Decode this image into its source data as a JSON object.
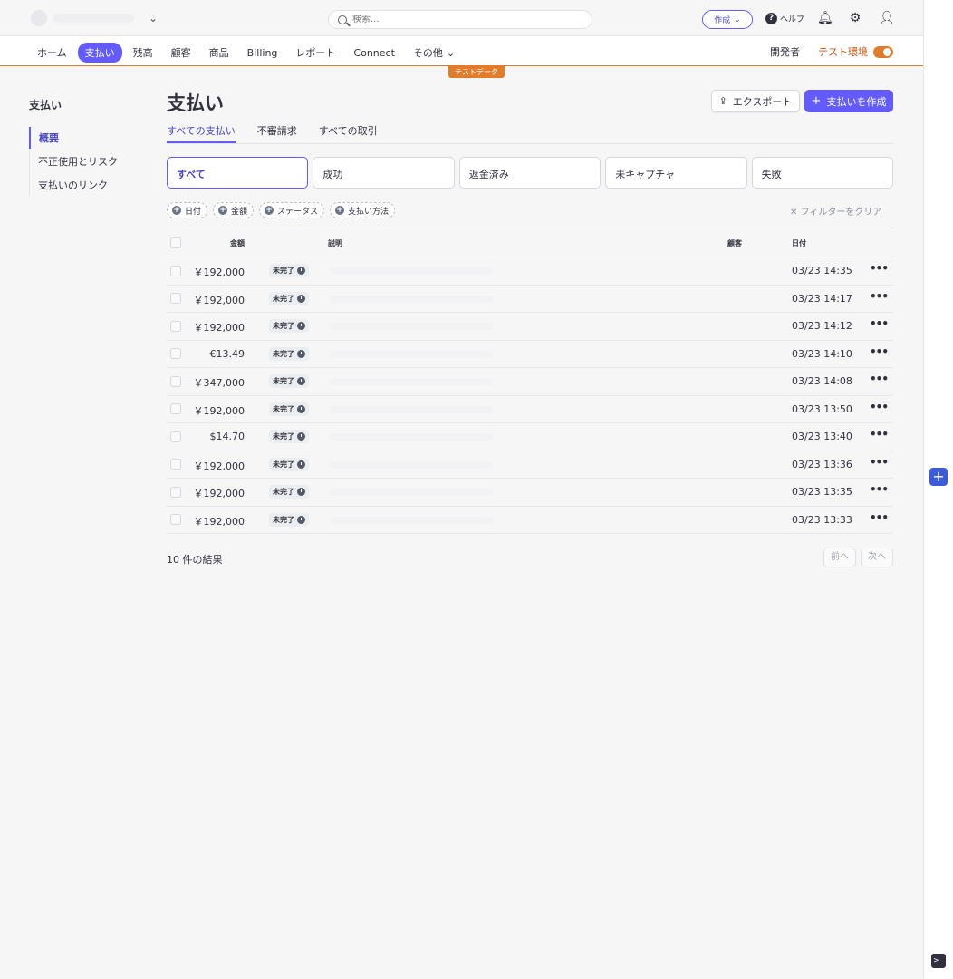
{
  "search": {
    "placeholder": "検索..."
  },
  "topbar": {
    "create_label": "作成",
    "help_label": "ヘルプ"
  },
  "nav": {
    "items": [
      {
        "label": "ホーム",
        "name": "nav-home",
        "active": false
      },
      {
        "label": "支払い",
        "name": "nav-payments",
        "active": true
      },
      {
        "label": "残高",
        "name": "nav-balances",
        "active": false
      },
      {
        "label": "顧客",
        "name": "nav-customers",
        "active": false
      },
      {
        "label": "商品",
        "name": "nav-products",
        "active": false
      },
      {
        "label": "Billing",
        "name": "nav-billing",
        "active": false
      },
      {
        "label": "レポート",
        "name": "nav-reports",
        "active": false
      },
      {
        "label": "Connect",
        "name": "nav-connect",
        "active": false
      },
      {
        "label": "その他",
        "name": "nav-more",
        "active": false
      }
    ],
    "developers": "開発者",
    "test_mode": "テスト環境",
    "test_badge": "テストデータ"
  },
  "sidebar": {
    "title": "支払い",
    "items": [
      {
        "label": "概要",
        "active": true
      },
      {
        "label": "不正使用とリスク",
        "active": false
      },
      {
        "label": "支払いのリンク",
        "active": false
      }
    ]
  },
  "page": {
    "title": "支払い",
    "export_label": "エクスポート",
    "create_label": "支払いを作成"
  },
  "tabs": [
    {
      "label": "すべての支払い",
      "active": true
    },
    {
      "label": "不審請求",
      "active": false
    },
    {
      "label": "すべての取引",
      "active": false
    }
  ],
  "status_filters": [
    {
      "label": "すべて",
      "active": true
    },
    {
      "label": "成功",
      "active": false
    },
    {
      "label": "返金済み",
      "active": false
    },
    {
      "label": "未キャプチャ",
      "active": false
    },
    {
      "label": "失敗",
      "active": false
    }
  ],
  "chips": [
    "日付",
    "金額",
    "ステータス",
    "支払い方法"
  ],
  "clear_filters": "フィルターをクリア",
  "table": {
    "headers": {
      "amount": "金額",
      "description": "説明",
      "customer": "顧客",
      "date": "日付"
    },
    "rows": [
      {
        "amount": "￥192,000",
        "status": "未完了",
        "date": "03/23 14:35"
      },
      {
        "amount": "￥192,000",
        "status": "未完了",
        "date": "03/23 14:17"
      },
      {
        "amount": "￥192,000",
        "status": "未完了",
        "date": "03/23 14:12"
      },
      {
        "amount": "€13.49",
        "status": "未完了",
        "date": "03/23 14:10"
      },
      {
        "amount": "￥347,000",
        "status": "未完了",
        "date": "03/23 14:08"
      },
      {
        "amount": "￥192,000",
        "status": "未完了",
        "date": "03/23 13:50"
      },
      {
        "amount": "$14.70",
        "status": "未完了",
        "date": "03/23 13:40"
      },
      {
        "amount": "￥192,000",
        "status": "未完了",
        "date": "03/23 13:36"
      },
      {
        "amount": "￥192,000",
        "status": "未完了",
        "date": "03/23 13:35"
      },
      {
        "amount": "￥192,000",
        "status": "未完了",
        "date": "03/23 13:33"
      }
    ]
  },
  "footer": {
    "result_count": "10 件の結果",
    "prev": "前へ",
    "next": "次へ"
  },
  "colors": {
    "accent": "#635bff",
    "test_orange": "#e27c2b"
  }
}
